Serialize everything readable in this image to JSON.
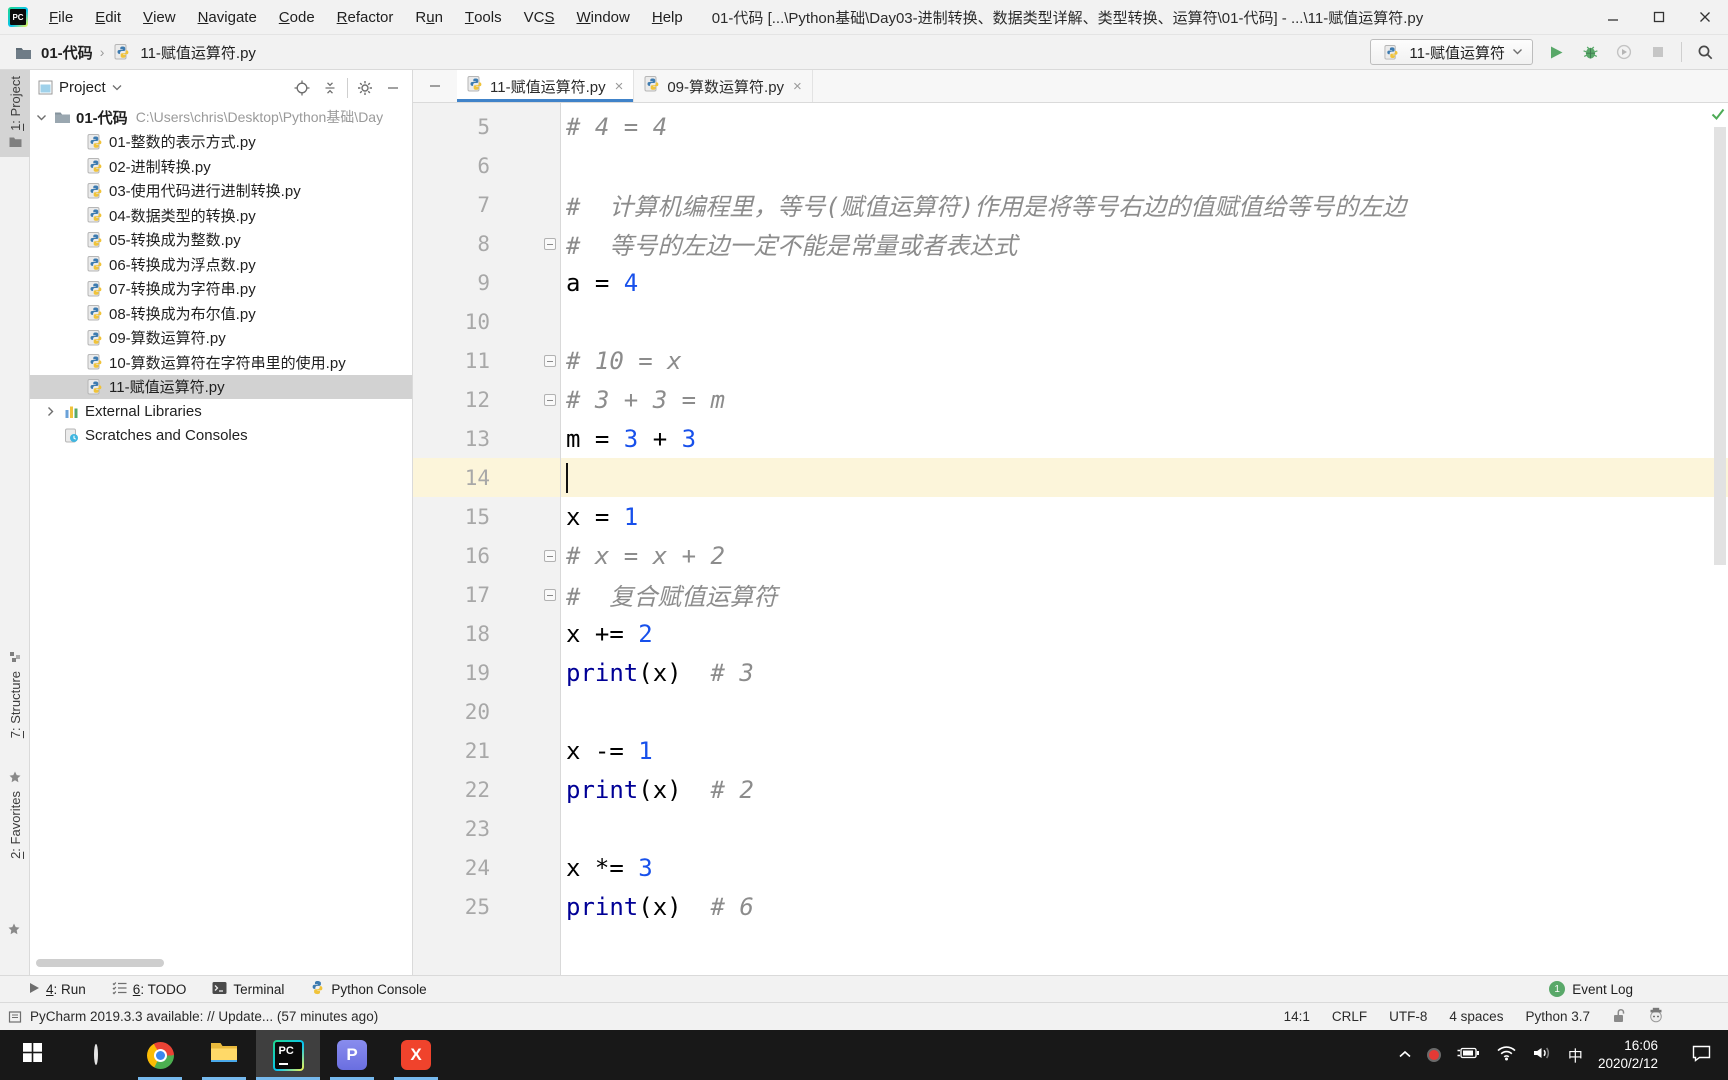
{
  "accent": {
    "blue": "#4083c9",
    "green": "#59a869",
    "selection": "#d2d2d2",
    "current_line": "#fcf5da",
    "number_color": "#1750eb",
    "builtin_color": "#000096",
    "comment_color": "#8c8c8c"
  },
  "window": {
    "title": "01-代码 [...\\Python基础\\Day03-进制转换、数据类型详解、类型转换、运算符\\01-代码] - ...\\11-赋值运算符.py",
    "menu": [
      {
        "label": "File",
        "u": 0
      },
      {
        "label": "Edit",
        "u": 0
      },
      {
        "label": "View",
        "u": 0
      },
      {
        "label": "Navigate",
        "u": 0
      },
      {
        "label": "Code",
        "u": 0
      },
      {
        "label": "Refactor",
        "u": 0
      },
      {
        "label": "Run",
        "u": 1
      },
      {
        "label": "Tools",
        "u": 0
      },
      {
        "label": "VCS",
        "u": 2
      },
      {
        "label": "Window",
        "u": 0
      },
      {
        "label": "Help",
        "u": 0
      }
    ]
  },
  "breadcrumb": {
    "folder": "01-代码",
    "separator": "›",
    "file": "11-赋值运算符.py"
  },
  "run_widget": {
    "config": "11-赋值运算符"
  },
  "stripe": {
    "items": [
      {
        "label": "1: Project",
        "u": 0,
        "active": true,
        "icon": "project"
      },
      {
        "label": "7: Structure",
        "u": 0,
        "active": false,
        "icon": "structure"
      },
      {
        "label": "2: Favorites",
        "u": 0,
        "active": false,
        "icon": "favorites"
      }
    ]
  },
  "project_panel": {
    "title": "Project",
    "root": {
      "name": "01-代码",
      "path": "C:\\Users\\chris\\Desktop\\Python基础\\Day"
    },
    "files": [
      "01-整数的表示方式.py",
      "02-进制转换.py",
      "03-使用代码进行进制转换.py",
      "04-数据类型的转换.py",
      "05-转换成为整数.py",
      "06-转换成为浮点数.py",
      "07-转换成为字符串.py",
      "08-转换成为布尔值.py",
      "09-算数运算符.py",
      "10-算数运算符在字符串里的使用.py",
      "11-赋值运算符.py"
    ],
    "selected_file": "11-赋值运算符.py",
    "special": [
      "External Libraries",
      "Scratches and Consoles"
    ]
  },
  "tabs": [
    {
      "label": "11-赋值运算符.py",
      "close": "×",
      "active": true
    },
    {
      "label": "09-算数运算符.py",
      "close": "×",
      "active": false
    }
  ],
  "editor": {
    "cursor_line": 14,
    "lines": [
      {
        "n": 5,
        "fold": false,
        "segs": [
          [
            "# 4 = 4",
            "c"
          ]
        ]
      },
      {
        "n": 6,
        "fold": false,
        "segs": []
      },
      {
        "n": 7,
        "fold": false,
        "segs": [
          [
            "#  计算机编程里，等号(赋值运算符)作用是将等号右边的值赋值给等号的左边",
            "c"
          ]
        ]
      },
      {
        "n": 8,
        "fold": true,
        "segs": [
          [
            "#  等号的左边一定不能是常量或者表达式",
            "c"
          ]
        ]
      },
      {
        "n": 9,
        "fold": false,
        "segs": [
          [
            "a = ",
            "p"
          ],
          [
            "4",
            "n"
          ]
        ]
      },
      {
        "n": 10,
        "fold": false,
        "segs": []
      },
      {
        "n": 11,
        "fold": true,
        "segs": [
          [
            "# 10 = x",
            "c"
          ]
        ]
      },
      {
        "n": 12,
        "fold": true,
        "segs": [
          [
            "# 3 + 3 = m",
            "c"
          ]
        ]
      },
      {
        "n": 13,
        "fold": false,
        "segs": [
          [
            "m = ",
            "p"
          ],
          [
            "3",
            "n"
          ],
          [
            " + ",
            "p"
          ],
          [
            "3",
            "n"
          ]
        ]
      },
      {
        "n": 14,
        "fold": false,
        "segs": []
      },
      {
        "n": 15,
        "fold": false,
        "segs": [
          [
            "x = ",
            "p"
          ],
          [
            "1",
            "n"
          ]
        ]
      },
      {
        "n": 16,
        "fold": true,
        "segs": [
          [
            "# x = x + 2",
            "c"
          ]
        ]
      },
      {
        "n": 17,
        "fold": true,
        "segs": [
          [
            "#  复合赋值运算符",
            "c"
          ]
        ]
      },
      {
        "n": 18,
        "fold": false,
        "segs": [
          [
            "x += ",
            "p"
          ],
          [
            "2",
            "n"
          ]
        ]
      },
      {
        "n": 19,
        "fold": false,
        "segs": [
          [
            "print",
            "b"
          ],
          [
            "(x)",
            "p"
          ],
          [
            "  # 3",
            "c"
          ]
        ]
      },
      {
        "n": 20,
        "fold": false,
        "segs": []
      },
      {
        "n": 21,
        "fold": false,
        "segs": [
          [
            "x -= ",
            "p"
          ],
          [
            "1",
            "n"
          ]
        ]
      },
      {
        "n": 22,
        "fold": false,
        "segs": [
          [
            "print",
            "b"
          ],
          [
            "(x)",
            "p"
          ],
          [
            "  # 2",
            "c"
          ]
        ]
      },
      {
        "n": 23,
        "fold": false,
        "segs": []
      },
      {
        "n": 24,
        "fold": false,
        "segs": [
          [
            "x *= ",
            "p"
          ],
          [
            "3",
            "n"
          ]
        ]
      },
      {
        "n": 25,
        "fold": false,
        "segs": [
          [
            "print",
            "b"
          ],
          [
            "(x)",
            "p"
          ],
          [
            "  # 6",
            "c"
          ]
        ]
      }
    ]
  },
  "bottom_bar": {
    "items": [
      {
        "label": "4: Run",
        "u": 0,
        "icon": "run-gray"
      },
      {
        "label": "6: TODO",
        "u": 0,
        "icon": "todo"
      },
      {
        "label": "Terminal",
        "icon": "terminal"
      },
      {
        "label": "Python Console",
        "icon": "python"
      }
    ],
    "event_log": {
      "count": "1",
      "label": "Event Log"
    }
  },
  "status_bar": {
    "message": "PyCharm 2019.3.3 available: // Update... (57 minutes ago)",
    "items": [
      "14:1",
      "CRLF",
      "UTF-8",
      "4 spaces",
      "Python 3.7"
    ]
  },
  "taskbar": {
    "apps": [
      {
        "name": "start",
        "running": false,
        "active": false
      },
      {
        "name": "cortana",
        "running": false,
        "active": false
      },
      {
        "name": "chrome",
        "running": true,
        "active": false
      },
      {
        "name": "explorer",
        "running": true,
        "active": false
      },
      {
        "name": "pycharm",
        "running": true,
        "active": true
      },
      {
        "name": "p-app",
        "running": true,
        "active": false
      },
      {
        "name": "xmind",
        "running": true,
        "active": false
      }
    ],
    "tray": {
      "ime": "中",
      "time": "16:06",
      "date": "2020/2/12"
    }
  }
}
